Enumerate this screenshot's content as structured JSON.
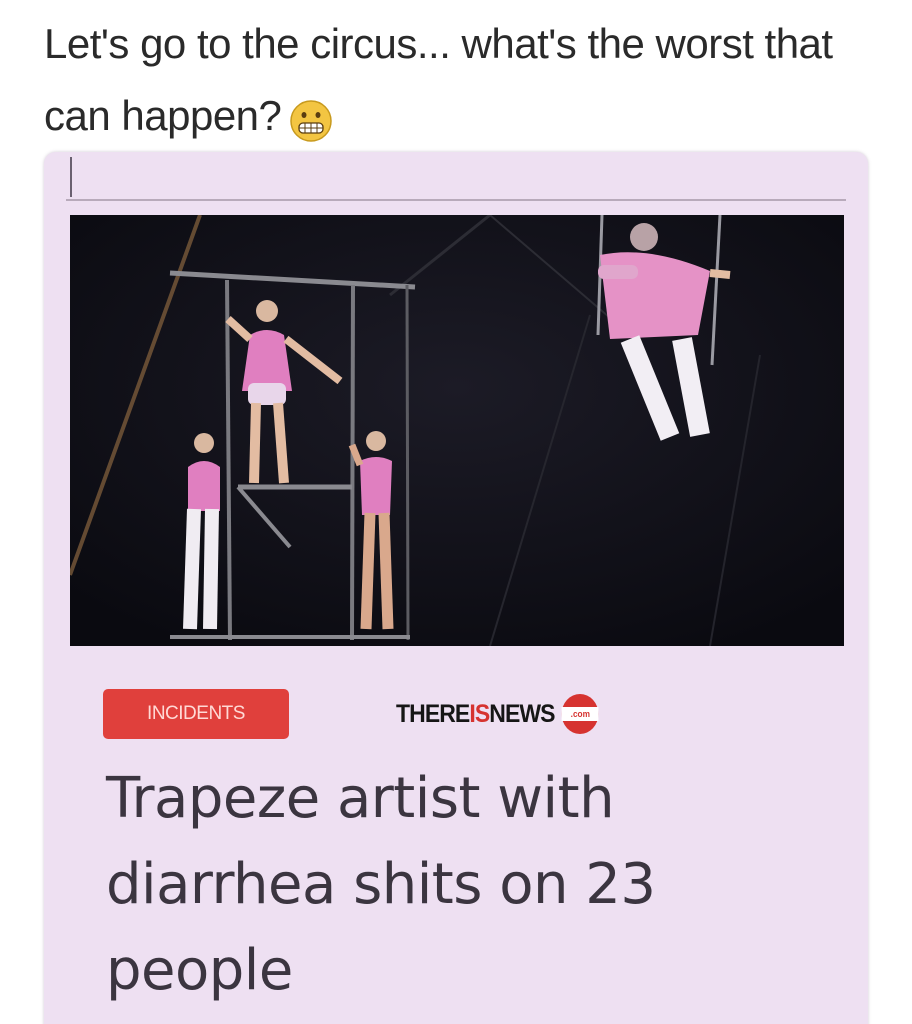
{
  "post": {
    "caption": "Let's go to the circus... what's the worst that can happen?",
    "caption_emoji": "grimacing-face"
  },
  "article": {
    "category_badge": "INCIDENTS",
    "source_logo": {
      "part1": "THERE",
      "part2": "IS",
      "part3": "NEWS",
      "suffix": ".com"
    },
    "headline": "Trapeze artist with diarrhea shits on 23 people",
    "photo": {
      "subject": "trapeze performers in pink leotards on a rig in a dark circus tent"
    }
  },
  "colors": {
    "card_background": "#eee0f2",
    "badge": "#e0403c",
    "brand_red": "#d63330",
    "text": "#2a2a2a"
  }
}
